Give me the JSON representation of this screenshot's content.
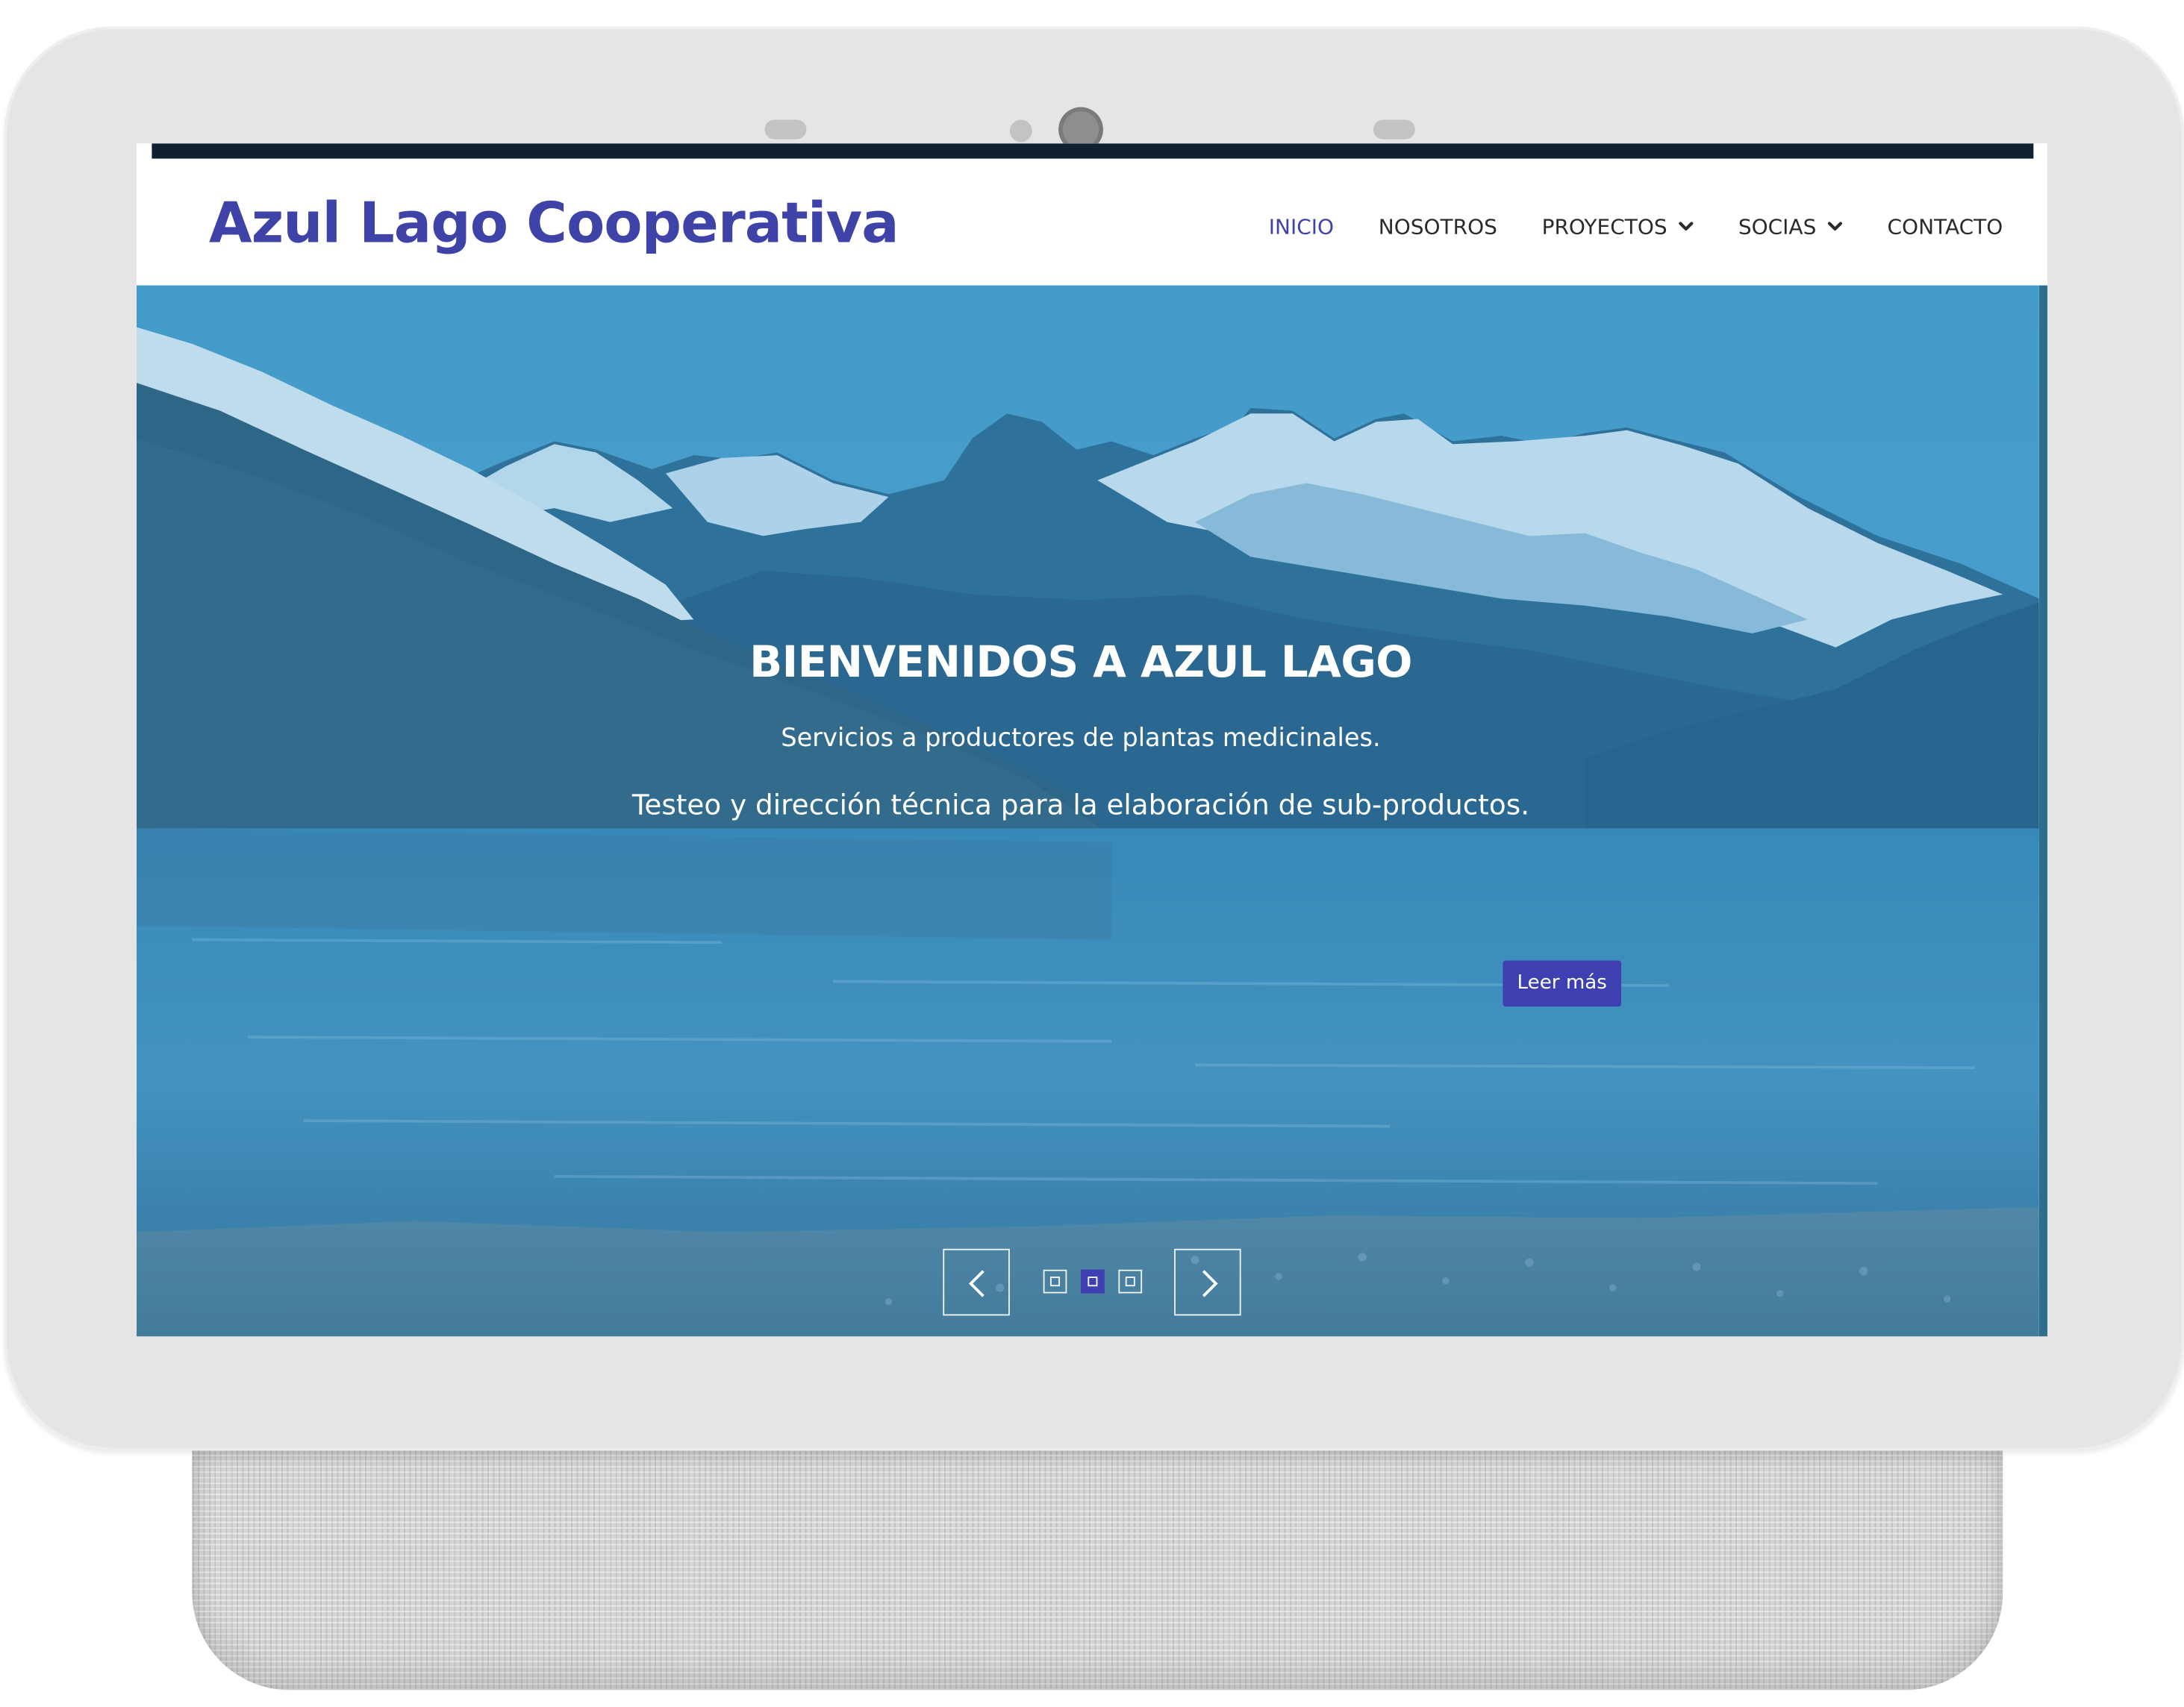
{
  "site": {
    "title": "Azul Lago Cooperativa"
  },
  "nav": {
    "items": [
      {
        "label": "INICIO",
        "active": true,
        "dropdown": false
      },
      {
        "label": "NOSOTROS",
        "active": false,
        "dropdown": false
      },
      {
        "label": "PROYECTOS",
        "active": false,
        "dropdown": true
      },
      {
        "label": "SOCIAS",
        "active": false,
        "dropdown": true
      },
      {
        "label": "CONTACTO",
        "active": false,
        "dropdown": false
      }
    ]
  },
  "hero": {
    "title": "BIENVENIDOS A AZUL LAGO",
    "subtitle_1": "Servicios a productores de plantas medicinales.",
    "subtitle_2": "Testeo y dirección técnica para la elaboración de sub-productos.",
    "button_label": "Leer más",
    "slides": {
      "count": 3,
      "active": 2
    }
  },
  "icons": {
    "prev": "chevron-left-icon",
    "next": "chevron-right-icon",
    "dropdown": "chevron-down-icon"
  },
  "colors": {
    "brand": "#3f43a8",
    "accent_button": "#3e3fb0",
    "topbar": "#0f2030",
    "overlay_tint": "#2f7fb6",
    "device_shell": "#e6e5e5"
  }
}
